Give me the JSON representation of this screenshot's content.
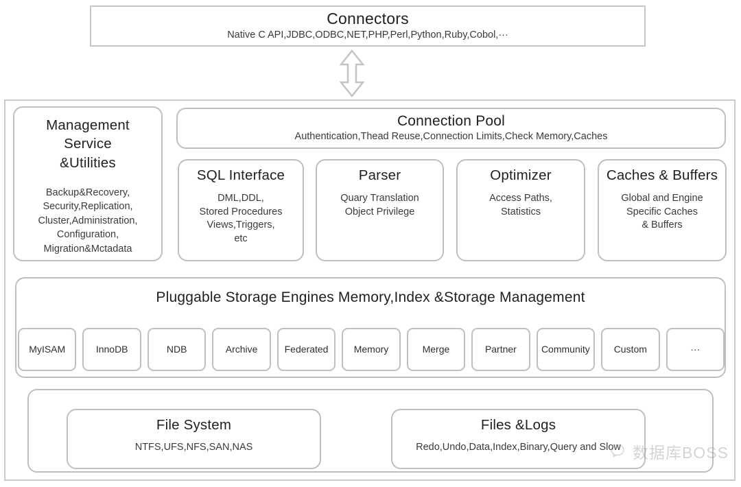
{
  "diagram": {
    "connectors": {
      "title": "Connectors",
      "subtitle": "Native C API,JDBC,ODBC,NET,PHP,Perl,Python,Ruby,Cobol,···"
    },
    "arrow": {
      "name": "double-headed-vertical-arrow"
    },
    "management": {
      "title": "Management\nService\n&Utilities",
      "title_lines": [
        "Management",
        "Service",
        "&Utilities"
      ],
      "subtitle": "Backup&Recovery,\nSecurity,Replication,\nCluster,Administration,\nConfiguration,\nMigration&Mctadata",
      "subtitle_lines": [
        "Backup&Recovery,",
        "Security,Replication,",
        "Cluster,Administration,",
        "Configuration,",
        "Migration&Mctadata"
      ]
    },
    "connection_pool": {
      "title": "Connection Pool",
      "subtitle": "Authentication,Thead Reuse,Connection Limits,Check Memory,Caches"
    },
    "services": [
      {
        "title": "SQL Interface",
        "subtitle_lines": [
          "DML,DDL,",
          "Stored Procedures",
          "Views,Triggers,",
          "etc"
        ]
      },
      {
        "title": "Parser",
        "subtitle_lines": [
          "Quary Translation",
          "Object Privilege"
        ]
      },
      {
        "title": "Optimizer",
        "subtitle_lines": [
          "Access Paths,",
          "Statistics"
        ]
      },
      {
        "title": "Caches & Buffers",
        "subtitle_lines": [
          "Global and Engine",
          "Specific Caches",
          "& Buffers"
        ]
      }
    ],
    "storage_engines": {
      "title": "Pluggable Storage Engines Memory,Index &Storage Management",
      "engines": [
        "MyISAM",
        "InnoDB",
        "NDB",
        "Archive",
        "Federat\ned",
        "Memory",
        "Merge",
        "Partner",
        "Commu\nnity",
        "Custom",
        "···"
      ]
    },
    "files": [
      {
        "title": "File System",
        "subtitle": "NTFS,UFS,NFS,SAN,NAS"
      },
      {
        "title": "Files &Logs",
        "subtitle": "Redo,Undo,Data,Index,Binary,Query and Slow"
      }
    ],
    "watermark": {
      "icon": "wechat-icon",
      "text": "数据库BOSS"
    },
    "colors": {
      "border": "#bfbfbf",
      "panel_border": "#c9c9c9",
      "text": "#2b2b2b",
      "background": "#ffffff",
      "watermark": "#9a9a9a"
    }
  }
}
